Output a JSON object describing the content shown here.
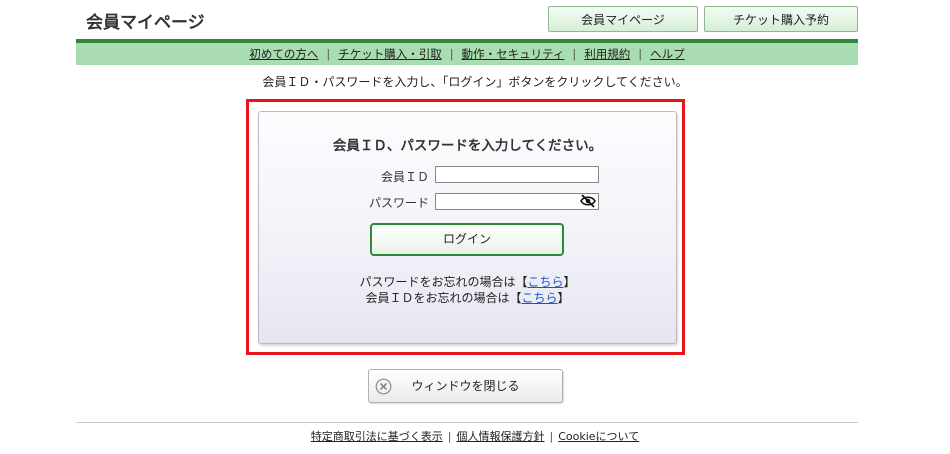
{
  "header": {
    "title": "会員マイページ",
    "buttons": {
      "mypage": "会員マイページ",
      "ticket": "チケット購入予約"
    }
  },
  "nav": {
    "items": [
      "初めての方へ",
      "チケット購入・引取",
      "動作・セキュリティ",
      "利用規約",
      "ヘルプ"
    ],
    "separator": "|"
  },
  "instruction": "会員ＩＤ・パスワードを入力し、「ログイン」ボタンをクリックしてください。",
  "login": {
    "heading": "会員ＩＤ、パスワードを入力してください。",
    "id_label": "会員ＩＤ",
    "id_value": "",
    "password_label": "パスワード",
    "password_value": "",
    "login_button": "ログイン",
    "forgot_password_prefix": "パスワードをお忘れの場合は【",
    "forgot_password_link": "こちら",
    "forgot_password_suffix": "】",
    "forgot_id_prefix": "会員ＩＤをお忘れの場合は【",
    "forgot_id_link": "こちら",
    "forgot_id_suffix": "】"
  },
  "close_button": "ウィンドウを閉じる",
  "footer": {
    "links": [
      "特定商取引法に基づく表示",
      "個人情報保護方針",
      "Cookieについて"
    ],
    "separator": "|"
  },
  "colors": {
    "accent_green": "#2e8a3a",
    "nav_green": "#a9dcb0",
    "highlight_red": "#e8141c",
    "link_blue": "#1a55c8"
  },
  "icons": {
    "password_toggle": "eye-slash-icon",
    "close": "close-circle-icon"
  }
}
